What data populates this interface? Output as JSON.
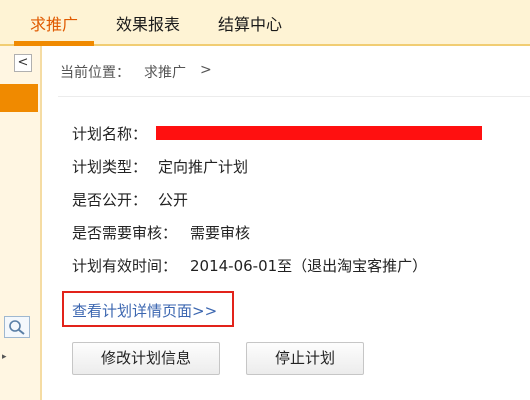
{
  "tabs": [
    {
      "label": "求推广",
      "active": true
    },
    {
      "label": "效果报表",
      "active": false
    },
    {
      "label": "结算中心",
      "active": false
    }
  ],
  "sidebar": {
    "collapse_icon": "chevron-left-icon",
    "collapse_glyph": "<",
    "search_icon": "search-icon"
  },
  "breadcrumb": {
    "label": "当前位置：",
    "current": "求推广",
    "separator": ">"
  },
  "plan": {
    "name_label": "计划名称：",
    "type_label": "计划类型：",
    "type_value": "定向推广计划",
    "public_label": "是否公开：",
    "public_value": "公开",
    "review_label": "是否需要审核：",
    "review_value": "需要审核",
    "period_label": "计划有效时间：",
    "period_value": "2014-06-01至（退出淘宝客推广）"
  },
  "detail_link": "查看计划详情页面>>",
  "buttons": {
    "edit": "修改计划信息",
    "stop": "停止计划"
  },
  "colors": {
    "accent": "#f08a00",
    "active_tab_text": "#e05a00",
    "link": "#3b66b0",
    "highlight_box": "#e2231a",
    "redaction": "#ff1010"
  }
}
